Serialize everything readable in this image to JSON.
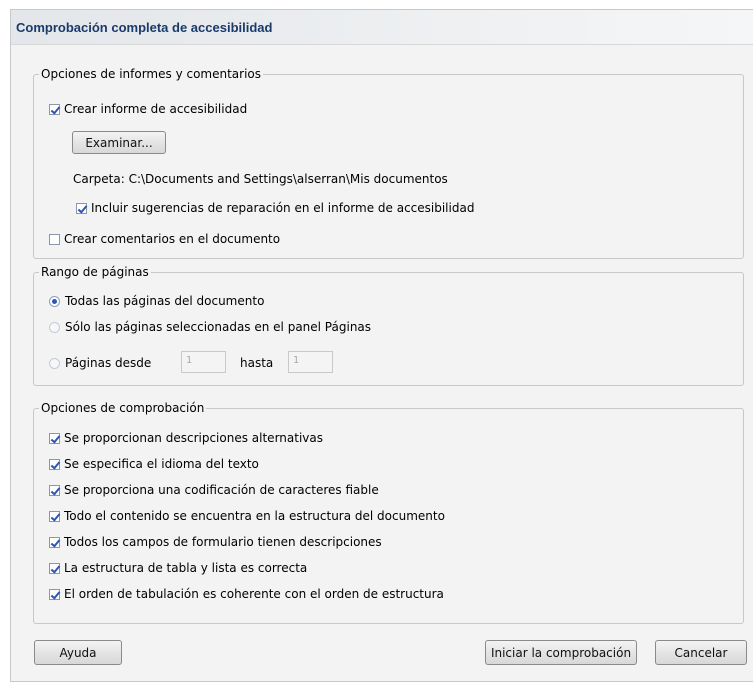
{
  "dialog": {
    "title": "Comprobación completa de accesibilidad"
  },
  "report_group": {
    "legend": "Opciones de informes y comentarios",
    "create_report": {
      "label": "Crear informe de accesibilidad",
      "checked": true
    },
    "browse_button": "Examinar...",
    "folder_text": "Carpeta: C:\\Documents and Settings\\alserran\\Mis documentos",
    "include_hints": {
      "label": "Incluir sugerencias de reparación en el informe de accesibilidad",
      "checked": true
    },
    "create_comments": {
      "label": "Crear comentarios en el documento",
      "checked": false
    }
  },
  "page_range": {
    "legend": "Rango de páginas",
    "all_pages": {
      "label": "Todas las páginas del documento",
      "selected": true
    },
    "selected_pages": {
      "label": "Sólo las páginas seleccionadas en el panel Páginas",
      "selected": false
    },
    "pages_from": {
      "label": "Páginas desde",
      "selected": false
    },
    "from_value": "1",
    "to_label": "hasta",
    "to_value": "1"
  },
  "check_options": {
    "legend": "Opciones de comprobación",
    "items": [
      {
        "label": "Se proporcionan descripciones alternativas",
        "checked": true
      },
      {
        "label": "Se especifica el idioma del texto",
        "checked": true
      },
      {
        "label": "Se proporciona una codificación de caracteres fiable",
        "checked": true
      },
      {
        "label": "Todo el contenido se encuentra en la estructura del documento",
        "checked": true
      },
      {
        "label": "Todos los campos de formulario tienen descripciones",
        "checked": true
      },
      {
        "label": "La estructura de tabla y lista es correcta",
        "checked": true
      },
      {
        "label": "El orden de tabulación es coherente con el orden de estructura",
        "checked": true
      }
    ]
  },
  "footer": {
    "help_button": "Ayuda",
    "start_button": "Iniciar la comprobación",
    "cancel_button": "Cancelar"
  },
  "colors": {
    "title_text": "#1a3a6a",
    "check_mark": "#2e55b0",
    "dialog_bg": "#f3f3f3"
  }
}
